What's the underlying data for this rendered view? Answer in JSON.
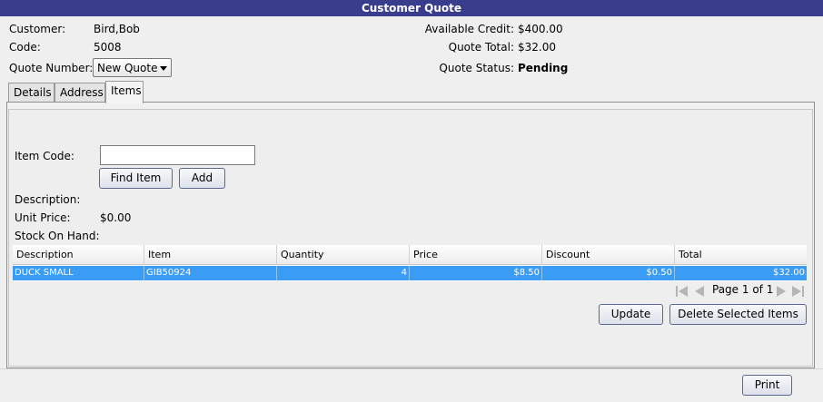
{
  "window": {
    "title": "Customer Quote"
  },
  "customer": {
    "customer_label": "Customer:",
    "customer_value": "Bird,Bob",
    "code_label": "Code:",
    "code_value": "5008",
    "quote_number_label": "Quote Number:",
    "quote_number_value": "New Quote"
  },
  "summary": {
    "available_credit_label": "Available Credit:",
    "available_credit_value": "$400.00",
    "quote_total_label": "Quote Total:",
    "quote_total_value": "$32.00",
    "quote_status_label": "Quote Status:",
    "quote_status_value": "Pending"
  },
  "tabs": [
    {
      "label": "Details",
      "active": false
    },
    {
      "label": "Address",
      "active": false
    },
    {
      "label": "Items",
      "active": true
    }
  ],
  "items_tab": {
    "item_code_label": "Item Code:",
    "item_code_value": "",
    "find_item_label": "Find Item",
    "add_label": "Add",
    "description_label": "Description:",
    "description_value": "",
    "unit_price_label": "Unit Price:",
    "unit_price_value": "$0.00",
    "stock_label": "Stock On Hand:",
    "stock_value": ""
  },
  "table": {
    "columns": [
      "Description",
      "Item",
      "Quantity",
      "Price",
      "Discount",
      "Total"
    ],
    "rows": [
      {
        "description": "DUCK SMALL",
        "item": "GIB50924",
        "quantity": "4",
        "price": "$8.50",
        "discount": "$0.50",
        "total": "$32.00",
        "selected": true
      }
    ]
  },
  "pager": {
    "text": "Page 1 of 1"
  },
  "actions": {
    "update_label": "Update",
    "delete_label": "Delete Selected Items",
    "print_label": "Print"
  },
  "colors": {
    "titlebar": "#3a3d8c",
    "selection": "#3b9cf5"
  }
}
